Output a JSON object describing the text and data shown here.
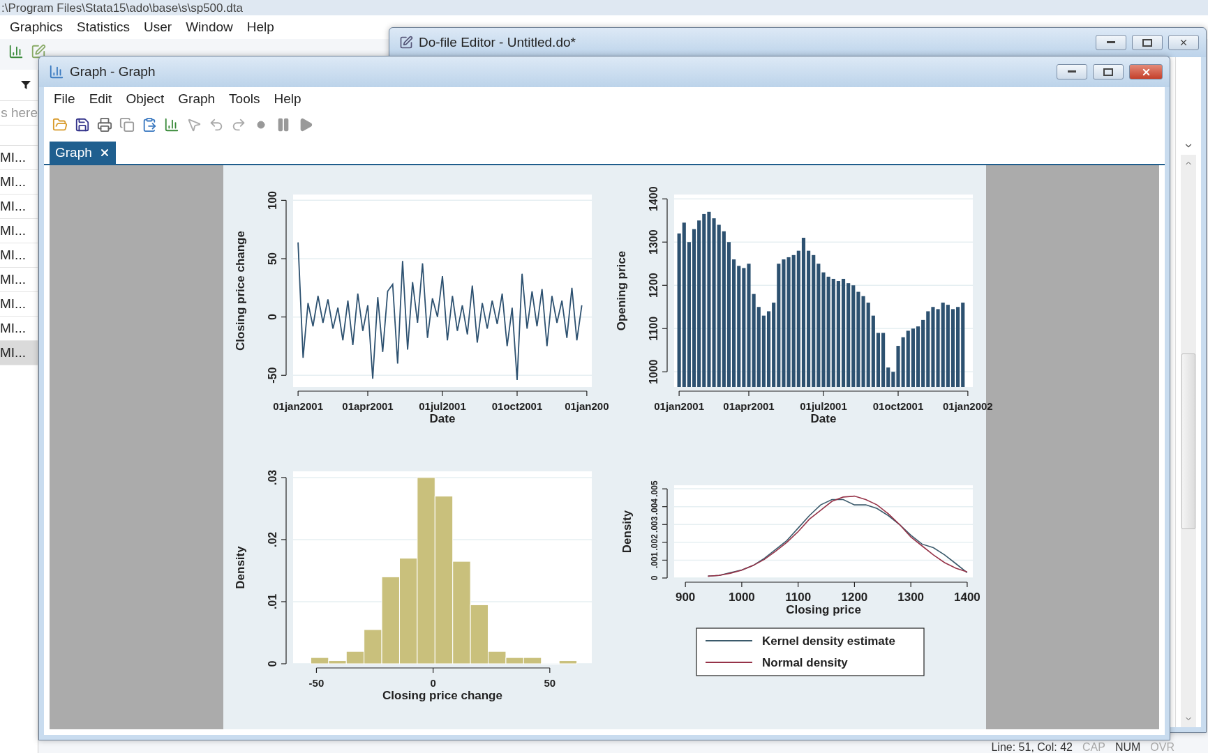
{
  "main_window": {
    "title": ":\\Program Files\\Stata15\\ado\\base\\s\\sp500.dta",
    "menu": [
      "Graphics",
      "Statistics",
      "User",
      "Window",
      "Help"
    ],
    "variables_filter": {
      "placeholder": "s here"
    },
    "variables": [
      {
        "name": "MI...",
        "selected": false
      },
      {
        "name": "MI...",
        "selected": false
      },
      {
        "name": "MI...",
        "selected": false
      },
      {
        "name": "MI...",
        "selected": false
      },
      {
        "name": "MI...",
        "selected": false
      },
      {
        "name": "MI...",
        "selected": false
      },
      {
        "name": "MI...",
        "selected": false
      },
      {
        "name": "MI...",
        "selected": false
      },
      {
        "name": "MI...",
        "selected": true
      }
    ],
    "status_bar": [
      {
        "text": "Line: 51, Col: 42",
        "enabled": true
      },
      {
        "text": "CAP",
        "enabled": false
      },
      {
        "text": "NUM",
        "enabled": true
      },
      {
        "text": "OVR",
        "enabled": false
      }
    ]
  },
  "dofile_window": {
    "title": "Do-file Editor - Untitled.do*"
  },
  "graph_window": {
    "title": "Graph - Graph",
    "menu": [
      "File",
      "Edit",
      "Object",
      "Graph",
      "Tools",
      "Help"
    ],
    "tabs": [
      {
        "label": "Graph",
        "selected": true
      }
    ],
    "charts": [
      {
        "chart_data": {
          "type": "line",
          "xlabel": "Date",
          "ylabel": "Closing price change",
          "ylim": [
            -60,
            105
          ],
          "grid": true,
          "categories": [
            "01jan2001",
            null,
            null,
            null,
            null,
            null,
            null,
            null,
            null,
            null,
            null,
            null,
            null,
            null,
            "01apr2001",
            null,
            null,
            null,
            null,
            null,
            null,
            null,
            null,
            null,
            null,
            null,
            null,
            null,
            null,
            "01jul2001",
            null,
            null,
            null,
            null,
            null,
            null,
            null,
            null,
            null,
            null,
            null,
            null,
            null,
            null,
            "01oct2001",
            null,
            null,
            null,
            null,
            null,
            null,
            null,
            null,
            null,
            null,
            null,
            null,
            null,
            "01jan200"
          ],
          "yticks": [
            -50,
            0,
            50,
            100
          ],
          "series": [
            {
              "color": "#2d5170",
              "values": [
                64,
                -35,
                12,
                -8,
                18,
                -5,
                15,
                -10,
                8,
                -20,
                14,
                -24,
                20,
                -12,
                10,
                -53,
                17,
                -30,
                22,
                28,
                -40,
                48,
                -28,
                30,
                -5,
                46,
                -18,
                16,
                0,
                35,
                -20,
                18,
                -12,
                10,
                -15,
                27,
                -22,
                12,
                -10,
                14,
                -6,
                20,
                -25,
                8,
                -54,
                37,
                -10,
                22,
                -8,
                24,
                -25,
                18,
                -5,
                14,
                -18,
                25,
                -20,
                10,
                null
              ]
            }
          ]
        }
      },
      {
        "chart_data": {
          "type": "bar",
          "xlabel": "Date",
          "ylabel": "Opening price",
          "ylim": [
            965,
            1410
          ],
          "grid": true,
          "categories": [
            "01jan2001",
            null,
            null,
            null,
            null,
            null,
            null,
            null,
            null,
            null,
            null,
            null,
            null,
            null,
            "01apr2001",
            null,
            null,
            null,
            null,
            null,
            null,
            null,
            null,
            null,
            null,
            null,
            null,
            null,
            null,
            "01jul2001",
            null,
            null,
            null,
            null,
            null,
            null,
            null,
            null,
            null,
            null,
            null,
            null,
            null,
            null,
            "01oct2001",
            null,
            null,
            null,
            null,
            null,
            null,
            null,
            null,
            null,
            null,
            null,
            null,
            null,
            "01jan2002"
          ],
          "yticks": [
            1000,
            1100,
            1200,
            1300,
            1400
          ],
          "series": [
            {
              "color": "#2d5170",
              "values": [
                1320,
                1345,
                1300,
                1330,
                1350,
                1365,
                1370,
                1355,
                1340,
                1325,
                1300,
                1260,
                1245,
                1240,
                1250,
                1180,
                1150,
                1130,
                1140,
                1160,
                1250,
                1260,
                1265,
                1270,
                1280,
                1310,
                1280,
                1270,
                1250,
                1230,
                1220,
                1215,
                1210,
                1215,
                1205,
                1200,
                1185,
                1175,
                1160,
                1130,
                1090,
                1090,
                1010,
                1000,
                1060,
                1080,
                1095,
                1100,
                1105,
                1120,
                1140,
                1150,
                1145,
                1160,
                1155,
                1145,
                1150,
                1160,
                null
              ]
            }
          ]
        }
      },
      {
        "chart_data": {
          "type": "bar",
          "xlabel": "Closing price change",
          "ylabel": "Density",
          "xlim": [
            -60,
            68
          ],
          "ylim": [
            0,
            0.031
          ],
          "grid": true,
          "xticks": [
            -50,
            0,
            50
          ],
          "yticks": [
            0,
            {
              "value": 0.01,
              "label": ".01"
            },
            {
              "value": 0.02,
              "label": ".02"
            },
            {
              "value": 0.03,
              "label": ".03"
            }
          ],
          "x": [
            -48.6,
            -41,
            -33.4,
            -25.8,
            -18.2,
            -10.6,
            -3,
            4.6,
            12.2,
            19.8,
            27.4,
            35,
            42.6,
            50.2,
            57.8
          ],
          "series": [
            {
              "color": "#c9c07c",
              "values": [
                0.001,
                0.0005,
                0.002,
                0.0055,
                0.014,
                0.017,
                0.03,
                0.027,
                0.0165,
                0.0095,
                0.002,
                0.001,
                0.001,
                0,
                0.0005
              ]
            }
          ]
        }
      },
      {
        "chart_data": {
          "type": "line",
          "xlabel": "Closing price",
          "ylabel": "Density",
          "xlim": [
            880,
            1410
          ],
          "ylim": [
            0,
            0.0052
          ],
          "grid": true,
          "legend": true,
          "xticks": [
            900,
            1000,
            1100,
            1200,
            1300,
            1400
          ],
          "yticks": [
            0,
            {
              "value": 0.001,
              "label": ".001"
            },
            {
              "value": 0.002,
              "label": ".002"
            },
            {
              "value": 0.003,
              "label": ".003"
            },
            {
              "value": 0.004,
              "label": ".004"
            },
            {
              "value": 0.005,
              "label": ".005"
            }
          ],
          "x": [
            940,
            960,
            980,
            1000,
            1020,
            1040,
            1060,
            1080,
            1100,
            1120,
            1140,
            1160,
            1180,
            1200,
            1220,
            1240,
            1260,
            1280,
            1300,
            1320,
            1340,
            1360,
            1380,
            1400
          ],
          "series": [
            {
              "name": "Kernel density estimate",
              "color": "#3b5a6b",
              "values": [
                0.0001,
                0.00015,
                0.0003,
                0.00045,
                0.0007,
                0.0011,
                0.0016,
                0.0021,
                0.0028,
                0.0035,
                0.0041,
                0.0044,
                0.0044,
                0.0041,
                0.0041,
                0.0039,
                0.0035,
                0.003,
                0.0024,
                0.0019,
                0.0017,
                0.0013,
                0.0008,
                0.0003
              ]
            },
            {
              "name": "Normal density",
              "color": "#963348",
              "values": [
                0.0001,
                0.00015,
                0.00027,
                0.00044,
                0.0007,
                0.00104,
                0.0015,
                0.002,
                0.0026,
                0.0033,
                0.0038,
                0.0043,
                0.00454,
                0.00459,
                0.0044,
                0.0041,
                0.0036,
                0.003,
                0.0023,
                0.0018,
                0.0013,
                0.00086,
                0.00055,
                0.00034
              ]
            }
          ]
        }
      }
    ]
  }
}
